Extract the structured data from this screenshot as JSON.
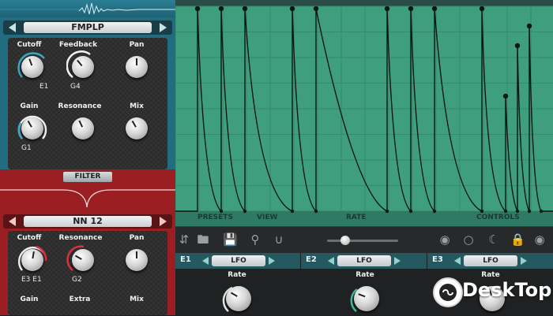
{
  "filter_module": {
    "preset_name": "FMPLP",
    "knobs": [
      {
        "label": "Cutoff",
        "modulation": "E1"
      },
      {
        "label": "Feedback",
        "modulation": "G4"
      },
      {
        "label": "Pan",
        "modulation": ""
      },
      {
        "label": "Gain",
        "modulation": "G1"
      },
      {
        "label": "Resonance",
        "modulation": ""
      },
      {
        "label": "Mix",
        "modulation": ""
      }
    ]
  },
  "filter_section_label": "FILTER",
  "filter_module_2": {
    "preset_name": "NN 12",
    "knobs": [
      {
        "label": "Cutoff",
        "modulation": "E3   E1"
      },
      {
        "label": "Resonance",
        "modulation": "G2"
      },
      {
        "label": "Pan",
        "modulation": ""
      },
      {
        "label": "Gain",
        "modulation": ""
      },
      {
        "label": "Extra",
        "modulation": ""
      },
      {
        "label": "Mix",
        "modulation": ""
      }
    ]
  },
  "graph": {
    "footer_labels": {
      "presets": "PRESETS",
      "view": "VIEW",
      "rate": "RATE",
      "controls": "CONTROLS"
    }
  },
  "toolbar": {
    "icons": [
      "updown-icon",
      "folder-icon",
      "save-icon",
      "search-icon",
      "magnet-icon",
      "zoom-slider",
      "circle-dot-icon",
      "circle-icon",
      "moon-icon",
      "lock-icon",
      "palette-icon"
    ]
  },
  "modulators": [
    {
      "id": "E1",
      "type": "LFO",
      "knob_label": "Rate"
    },
    {
      "id": "E2",
      "type": "LFO",
      "knob_label": "Rate"
    },
    {
      "id": "E3",
      "type": "LFO",
      "knob_label": "Rate"
    }
  ],
  "watermark": {
    "text": "DeskTop"
  },
  "colors": {
    "teal": "#216d7f",
    "red": "#9b1e22",
    "graph_green": "#3a9a7a",
    "accent": "#26595f"
  }
}
